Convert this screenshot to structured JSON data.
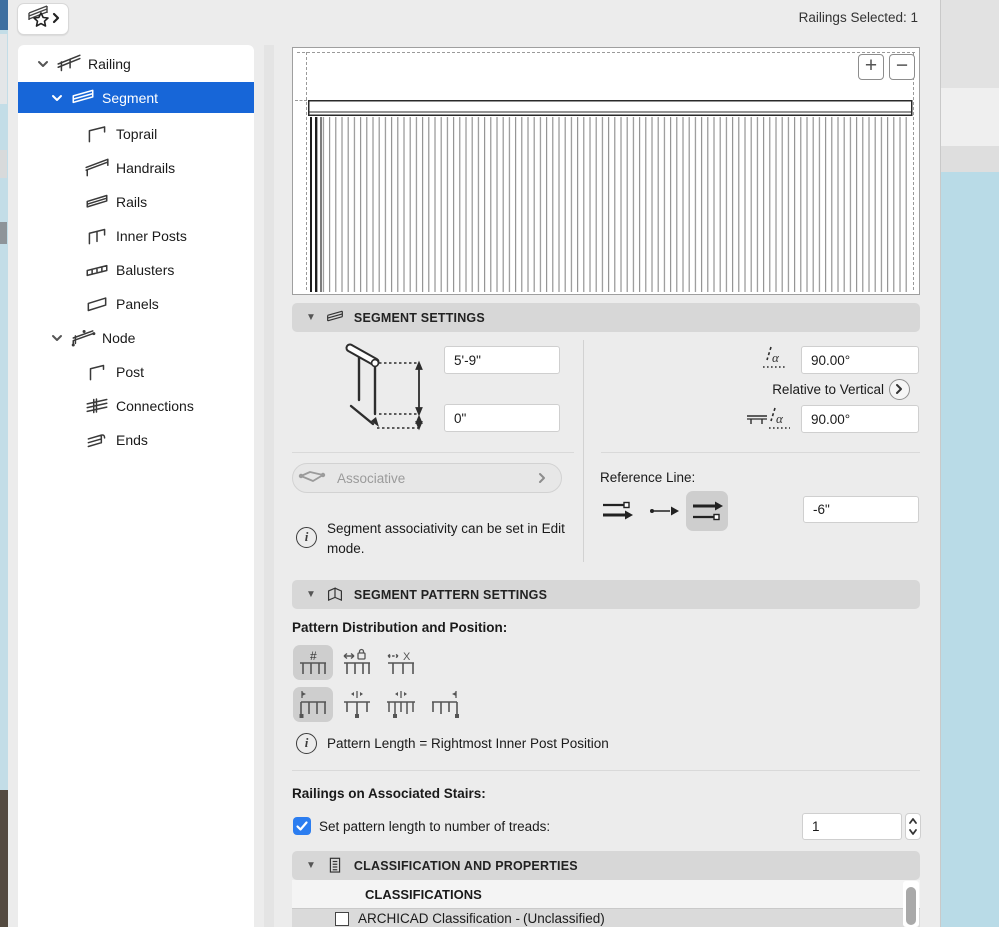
{
  "colors": {
    "accent_blue": "#1766d8",
    "checkbox_blue": "#2b7df0",
    "background_blue": "#b9dbe7"
  },
  "titlebar": {
    "selection_status": "Railings Selected: 1"
  },
  "sidebar": {
    "items": [
      {
        "label": "Railing",
        "level": 0,
        "expanded": true,
        "selected": false
      },
      {
        "label": "Segment",
        "level": 1,
        "expanded": true,
        "selected": true
      },
      {
        "label": "Toprail",
        "level": 2
      },
      {
        "label": "Handrails",
        "level": 2
      },
      {
        "label": "Rails",
        "level": 2
      },
      {
        "label": "Inner Posts",
        "level": 2
      },
      {
        "label": "Balusters",
        "level": 2
      },
      {
        "label": "Panels",
        "level": 2
      },
      {
        "label": "Node",
        "level": 1,
        "expanded": true
      },
      {
        "label": "Post",
        "level": 2
      },
      {
        "label": "Connections",
        "level": 2
      },
      {
        "label": "Ends",
        "level": 2
      }
    ]
  },
  "preview": {
    "zoom_in": "+",
    "zoom_out": "−"
  },
  "segment_settings": {
    "title": "SEGMENT SETTINGS",
    "height_top_value": "5'-9\"",
    "height_bottom_value": "0\"",
    "top_angle_value": "90.00°",
    "bottom_angle_value": "90.00°",
    "relative_label": "Relative to Vertical",
    "associative_label": "Associative",
    "associative_info": "Segment associativity can be set in Edit mode.",
    "reference_line_label": "Reference Line:",
    "reference_offset_value": "-6\""
  },
  "pattern_settings": {
    "title": "SEGMENT PATTERN SETTINGS",
    "distribution_label": "Pattern Distribution and Position:",
    "info": "Pattern Length = Rightmost Inner Post Position",
    "stairs_label": "Railings on Associated Stairs:",
    "treads_checkbox_label": "Set pattern length to number of treads:",
    "treads_value": "1"
  },
  "classification": {
    "title": "CLASSIFICATION AND PROPERTIES",
    "subheader": "CLASSIFICATIONS",
    "row_name": "ARCHICAD Classification - ",
    "row_value": "(Unclassified)"
  },
  "icons": {
    "alpha": "α",
    "hash": "#",
    "x_mark": "X",
    "arrows": "↔",
    "triangle_down": "▼"
  }
}
